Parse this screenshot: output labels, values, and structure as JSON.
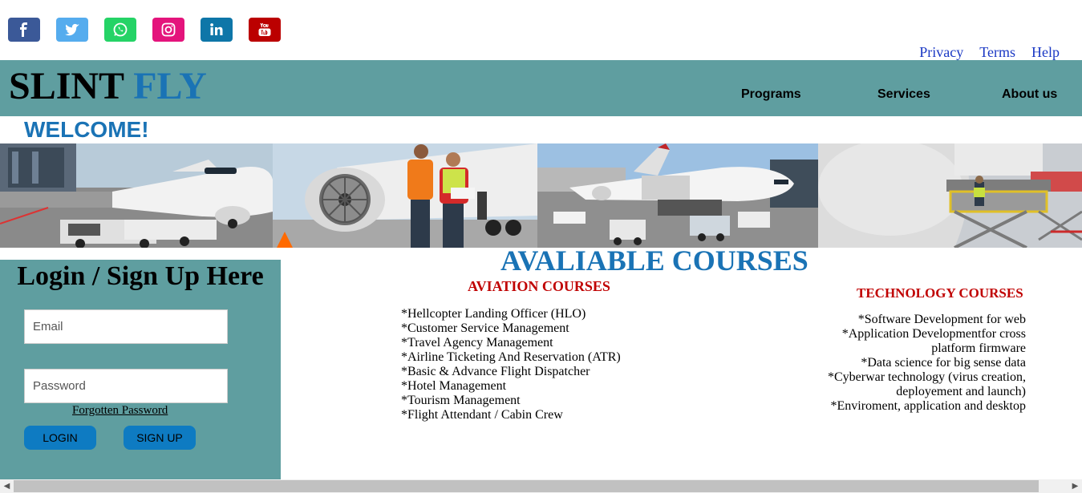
{
  "social": [
    {
      "name": "facebook-icon",
      "color": "#3b5998"
    },
    {
      "name": "twitter-icon",
      "color": "#55acee"
    },
    {
      "name": "whatsapp-icon",
      "color": "#25d366"
    },
    {
      "name": "instagram-icon",
      "color": "#e4147c"
    },
    {
      "name": "linkedin-icon",
      "color": "#0e76a8"
    },
    {
      "name": "youtube-icon",
      "color": "#bb0000"
    }
  ],
  "toplinks": {
    "privacy": "Privacy",
    "terms": "Terms",
    "help": "Help"
  },
  "header": {
    "logo_part1": "SLINT",
    "logo_part2": "FLY",
    "nav": {
      "programs": "Programs",
      "services": "Services",
      "about": "About us"
    }
  },
  "welcome": "WELCOME!",
  "login": {
    "title": "Login / Sign Up Here",
    "email_placeholder": "Email",
    "password_placeholder": "Password",
    "forgot": "Forgotten Password",
    "login_button": "LOGIN",
    "signup_button": "SIGN UP"
  },
  "courses": {
    "title": "AVALIABLE COURSES",
    "aviation_title": "AVIATION COURSES",
    "aviation": [
      "*Hellcopter Landing Officer (HLO)",
      "*Customer Service Management",
      "*Travel Agency Management",
      "*Airline Ticketing And Reservation (ATR)",
      "*Basic & Advance Flight Dispatcher",
      "*Hotel Management",
      "*Tourism Management",
      "*Flight Attendant / Cabin Crew"
    ],
    "technology_title": "TECHNOLOGY COURSES",
    "technology": [
      "*Software Development for web",
      "*Application Developmentfor cross platform firmware",
      "*Data science for big sense data",
      "*Cyberwar technology (virus creation, deployement and launch)",
      "*Enviroment, application and desktop"
    ]
  },
  "colors": {
    "header_bg": "#5f9ea0",
    "accent_blue": "#1a73b5",
    "course_red": "#c00000",
    "button_blue": "#0e7bc2"
  }
}
